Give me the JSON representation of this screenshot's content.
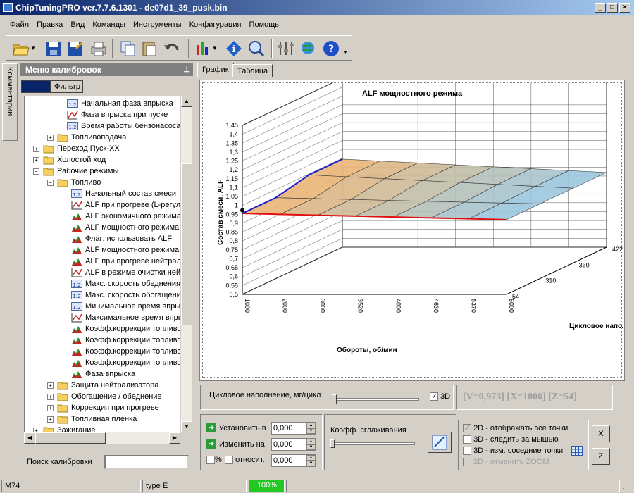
{
  "window": {
    "title": "ChipTuningPRO ver.7.7.6.1301 - de07d1_39_pusk.bin"
  },
  "menu": [
    "Файл",
    "Правка",
    "Вид",
    "Команды",
    "Инструменты",
    "Конфигурация",
    "Помощь"
  ],
  "side_tab": "Комментарии",
  "calib_panel": {
    "title": "Меню калибровок",
    "tabs": [
      "",
      "Фильтр"
    ]
  },
  "tree": [
    {
      "label": "Начальная фаза впрыска",
      "icon": "table-icon"
    },
    {
      "label": "Фаза впрыска при пуске",
      "icon": "curve-icon"
    },
    {
      "label": "Время работы бензонасоса",
      "icon": "table-icon"
    },
    {
      "label": "Топливоподача",
      "icon": "folder-icon"
    },
    {
      "label": "Переход Пуск-ХХ",
      "icon": "folder-icon"
    },
    {
      "label": "Холостой ход",
      "icon": "folder-icon"
    },
    {
      "label": "Рабочие режимы",
      "icon": "folder-icon"
    },
    {
      "label": "Топливо",
      "icon": "folder-icon"
    },
    {
      "label": "Начальный состав смеси",
      "icon": "table-icon"
    },
    {
      "label": "ALF при прогреве (L-регулирование)",
      "icon": "curve-icon"
    },
    {
      "label": "ALF экономичного режима",
      "icon": "map3d-icon"
    },
    {
      "label": "ALF мощностного режима",
      "icon": "map3d-icon"
    },
    {
      "label": "Флаг: использовать ALF",
      "icon": "map3d-icon"
    },
    {
      "label": "ALF мощностного режима",
      "icon": "map3d-icon"
    },
    {
      "label": "ALF при прогреве нейтрализатора",
      "icon": "map3d-icon"
    },
    {
      "label": "ALF в режиме очистки нейтрализатора",
      "icon": "curve-icon"
    },
    {
      "label": "Макс. скорость обеднения",
      "icon": "table-icon"
    },
    {
      "label": "Макс. скорость обогащения",
      "icon": "table-icon"
    },
    {
      "label": "Минимальное время впрыска",
      "icon": "table-icon"
    },
    {
      "label": "Максимальное время впрыска",
      "icon": "curve-icon"
    },
    {
      "label": "Коэфф.коррекции топливоподачи",
      "icon": "map3d-icon"
    },
    {
      "label": "Коэфф.коррекции топливоподачи",
      "icon": "map3d-icon"
    },
    {
      "label": "Коэфф.коррекции топливоподачи",
      "icon": "map3d-icon"
    },
    {
      "label": "Коэфф.коррекции топливоподачи",
      "icon": "map3d-icon"
    },
    {
      "label": "Фаза впрыска",
      "icon": "map3d-icon"
    },
    {
      "label": "Защита нейтрализатора",
      "icon": "folder-icon"
    },
    {
      "label": "Обогащение / обеднение",
      "icon": "folder-icon"
    },
    {
      "label": "Коррекция при прогреве",
      "icon": "folder-icon"
    },
    {
      "label": "Топливная пленка",
      "icon": "folder-icon"
    },
    {
      "label": "Зажигание",
      "icon": "folder-icon"
    }
  ],
  "search": {
    "label": "Поиск калибровки",
    "value": ""
  },
  "view_tabs": [
    "График",
    "Таблица"
  ],
  "chart_data": {
    "type": "surface3d",
    "title": "ALF мощностного режима",
    "ylabel": "Состав смеси, ALF",
    "xlabel": "Обороты, об/мин",
    "zlabel": "Цикловое наполнение",
    "y_ticks": [
      "1,45",
      "1,4",
      "1,35",
      "1,3",
      "1,25",
      "1,2",
      "1,15",
      "1,1",
      "1,05",
      "1",
      "0,95",
      "0,9",
      "0,85",
      "0,8",
      "0,75",
      "0,7",
      "0,65",
      "0,6",
      "0,55",
      "0,5"
    ],
    "x_ticks": [
      "1000",
      "2000",
      "3000",
      "3520",
      "4000",
      "4630",
      "5370",
      "6000"
    ],
    "z_ticks": [
      "54",
      "310",
      "360",
      "422"
    ],
    "ylim": [
      0.5,
      1.45
    ],
    "selected_point": {
      "v": 0.973,
      "x": 1000,
      "z": 54
    }
  },
  "controls": {
    "fill_label": "Цикловое наполнение, мг/цикл",
    "check_3d": "3D",
    "readout": "[V=0,973] [X=1000] [Z=54]",
    "set_label": "Установить в",
    "change_label": "Изменить на",
    "set_value": "0,000",
    "change_value": "0,000",
    "pct_label": "%",
    "rel_label": "относит.",
    "rel_value": "0,000",
    "smooth_label": "Коэфф. сглаживания",
    "opt_all_points": "2D - отображать все точки",
    "opt_follow_mouse": "3D - следить за мышью",
    "opt_neighbors": "3D - изм. соседние точки",
    "opt_zoom": "2D - отменить ZOOM",
    "btn_x": "X",
    "btn_z": "Z"
  },
  "status": {
    "left": "M74",
    "mid": "type E",
    "progress": "100%"
  }
}
